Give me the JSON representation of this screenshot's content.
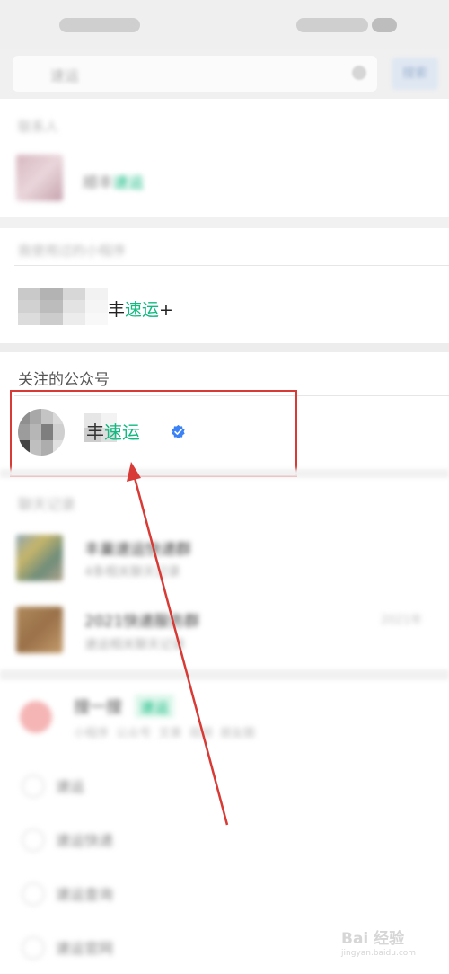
{
  "search": {
    "query": "速运",
    "button_label": "搜索"
  },
  "sections": {
    "contacts": {
      "label": "联系人",
      "item_text": "速运"
    },
    "mini_program": {
      "label": "我使用过的小程序",
      "name_prefix": "丰",
      "name_highlight": "速运",
      "name_suffix": "+"
    },
    "official_accounts": {
      "label": "关注的公众号",
      "name_prefix": "丰",
      "name_highlight": "速运"
    },
    "chat_history": {
      "label": "聊天记录",
      "items": [
        {
          "title": "丰巢速运快递群",
          "subtitle": "4条相关聊天记录"
        },
        {
          "title": "2021快递服务群",
          "subtitle": "速运相关聊天记录",
          "time": "2021年"
        }
      ]
    },
    "search_one": {
      "title": "搜一搜",
      "tag": "速运",
      "subtitle": "小程序  公众号  文章  视频  朋友圈",
      "suggestions": [
        "速运",
        "速运快递",
        "速运查询",
        "速运官网"
      ]
    }
  },
  "watermark": {
    "text": "Bai 经验",
    "subtext": "jingyan.baidu.com"
  },
  "colors": {
    "highlight_green": "#12b981",
    "annotation_red": "#d83a35",
    "verified_blue": "#3b82f6"
  }
}
